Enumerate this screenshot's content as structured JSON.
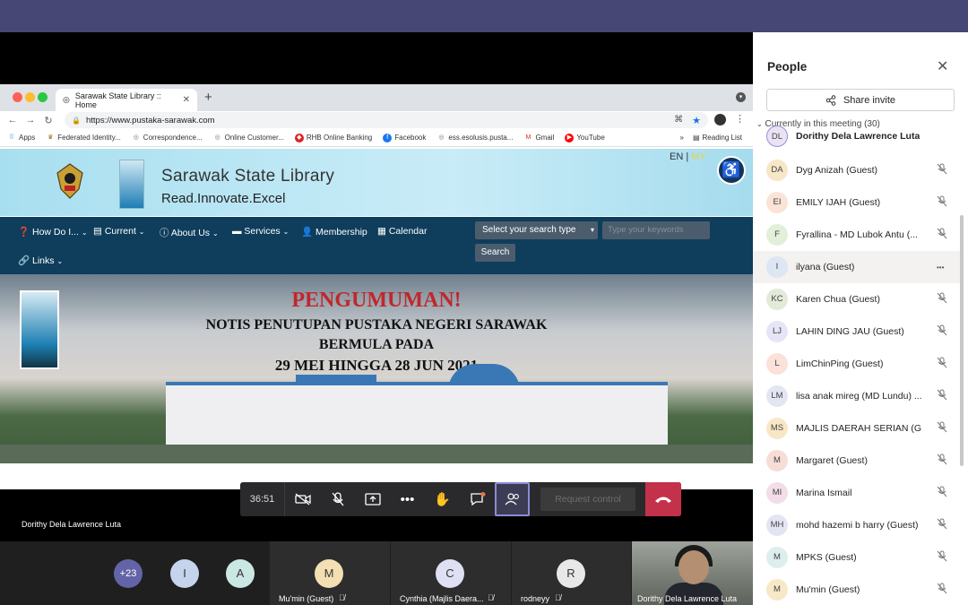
{
  "browser": {
    "tab_title": "Sarawak State Library :: Home",
    "tab_close": "✕",
    "new_tab": "+",
    "url": "https://www.pustaka-sarawak.com",
    "bookmarks": [
      {
        "label": "Apps",
        "icon": "apps-grid-icon"
      },
      {
        "label": "Federated Identity...",
        "icon": "crest-icon"
      },
      {
        "label": "Correspondence...",
        "icon": "globe-icon"
      },
      {
        "label": "Online Customer...",
        "icon": "globe-icon"
      },
      {
        "label": "RHB Online Banking",
        "icon": "diamond-icon"
      },
      {
        "label": "Facebook",
        "icon": "facebook-icon"
      },
      {
        "label": "ess.esolusis.pusta...",
        "icon": "globe-icon"
      },
      {
        "label": "Gmail",
        "icon": "gmail-icon"
      },
      {
        "label": "YouTube",
        "icon": "youtube-icon"
      }
    ],
    "more_bookmarks": "»",
    "reading_list": "Reading List"
  },
  "site": {
    "title": "Sarawak State Library",
    "tagline": "Read.Innovate.Excel",
    "lang_en": "EN",
    "lang_sep": " | ",
    "lang_my": "MY",
    "nav": {
      "how_do_i": "How Do I...",
      "current": "Current",
      "about_us": "About Us",
      "services": "Services",
      "membership": "Membership",
      "calendar": "Calendar",
      "links": "Links"
    },
    "search_type": "Select your search type",
    "search_placeholder": "Type your keywords",
    "search_button": "Search",
    "banner": {
      "line1": "PENGUMUMAN!",
      "line2": "NOTIS PENUTUPAN PUSTAKA NEGERI SARAWAK",
      "line3": "BERMULA PADA",
      "line4": "29 MEI  HINGGA 28 JUN 2021"
    }
  },
  "call": {
    "timer": "36:51",
    "request_control": "Request control",
    "presenter_name": "Dorithy Dela Lawrence Luta",
    "accent": "#c4314b"
  },
  "strip": {
    "overflow": "+23",
    "avatars": [
      "I",
      "A"
    ],
    "tiles": [
      {
        "initial": "M",
        "name": "Mu'min (Guest)"
      },
      {
        "initial": "C",
        "name": "Cynthia (Majlis Daera..."
      },
      {
        "initial": "R",
        "name": "rodneyy"
      }
    ],
    "video_name": "Dorithy Dela Lawrence Luta"
  },
  "people": {
    "title": "People",
    "share_invite": "Share invite",
    "currently": "Currently in this meeting (30)",
    "participants": [
      {
        "initials": "DL",
        "name": "Dorithy Dela Lawrence Luta",
        "color": "#e9e3f5"
      },
      {
        "initials": "DA",
        "name": "Dyg Anizah (Guest)",
        "color": "#f7e6c7"
      },
      {
        "initials": "EI",
        "name": "EMILY IJAH (Guest)",
        "color": "#fbe3d6"
      },
      {
        "initials": "F",
        "name": "Fyrallina - MD Lubok Antu (...",
        "color": "#e2efd9"
      },
      {
        "initials": "I",
        "name": "ilyana (Guest)",
        "color": "#dde6f3"
      },
      {
        "initials": "KC",
        "name": "Karen Chua (Guest)",
        "color": "#e3ead8"
      },
      {
        "initials": "LJ",
        "name": "LAHIN DING JAU (Guest)",
        "color": "#e5e5f7"
      },
      {
        "initials": "L",
        "name": "LimChinPing (Guest)",
        "color": "#fbe1d8"
      },
      {
        "initials": "LM",
        "name": "lisa anak mireg (MD Lundu) ...",
        "color": "#e3e6f2"
      },
      {
        "initials": "MS",
        "name": "MAJLIS DAERAH SERIAN (G...",
        "color": "#f8e7c6"
      },
      {
        "initials": "M",
        "name": "Margaret (Guest)",
        "color": "#f6ddd6"
      },
      {
        "initials": "MI",
        "name": "Marina Ismail",
        "color": "#f3dde8"
      },
      {
        "initials": "MH",
        "name": "mohd hazemi b harry (Guest)",
        "color": "#e3e6f2"
      },
      {
        "initials": "M",
        "name": "MPKS (Guest)",
        "color": "#dcefee"
      },
      {
        "initials": "M",
        "name": "Mu'min (Guest)",
        "color": "#f7e8c8"
      }
    ]
  }
}
